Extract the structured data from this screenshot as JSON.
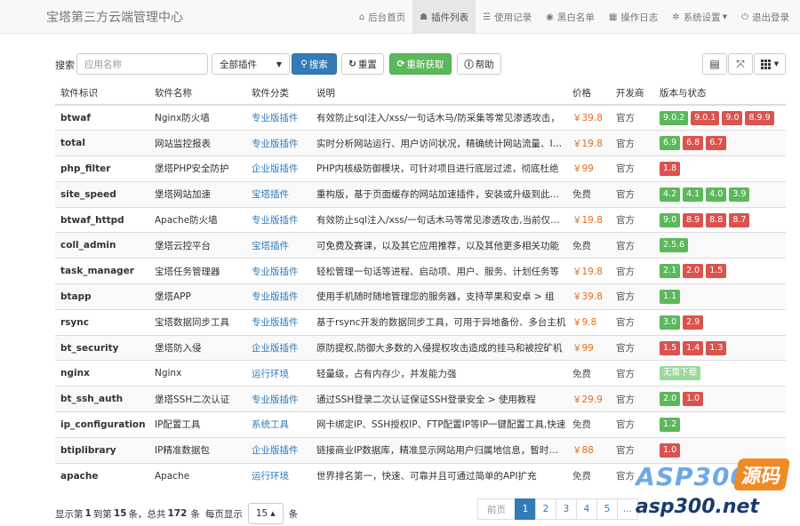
{
  "header": {
    "title": "宝塔第三方云端管理中心",
    "nav": [
      {
        "label": "后台首页",
        "icon": "home-icon",
        "glyph": "⌂"
      },
      {
        "label": "插件列表",
        "icon": "cubes-icon",
        "glyph": "☗"
      },
      {
        "label": "使用记录",
        "icon": "list-icon",
        "glyph": "☰"
      },
      {
        "label": "黑白名单",
        "icon": "globe-icon",
        "glyph": "◉"
      },
      {
        "label": "操作日志",
        "icon": "calendar-icon",
        "glyph": "▦"
      },
      {
        "label": "系统设置",
        "icon": "gear-icon",
        "glyph": "✲"
      },
      {
        "label": "退出登录",
        "icon": "power-icon",
        "glyph": "⏻"
      }
    ]
  },
  "toolbar": {
    "search_label": "搜索",
    "search_placeholder": "应用名称",
    "category_select": "全部插件",
    "search_button": "搜索",
    "reset_button": "重置",
    "refresh_button": "重新获取",
    "help_button": "帮助"
  },
  "table": {
    "columns": [
      "软件标识",
      "软件名称",
      "软件分类",
      "说明",
      "价格",
      "开发商",
      "版本与状态"
    ],
    "rows": [
      {
        "id": "btwaf",
        "name": "Nginx防火墙",
        "category": "专业版插件",
        "desc": "有效防止sql注入/xss/一句话木马/防采集等常见渗透攻击，",
        "price": "￥39.8",
        "vendor": "官方",
        "versions": [
          {
            "v": "9.0.2",
            "c": "green"
          },
          {
            "v": "9.0.1",
            "c": "red"
          },
          {
            "v": "9.0",
            "c": "red"
          },
          {
            "v": "8.9.9",
            "c": "red"
          }
        ]
      },
      {
        "id": "total",
        "name": "网站监控报表",
        "category": "专业版插件",
        "desc": "实时分析网站运行、用户访问状况，精确统计网站流量、IP、UV、PV",
        "price": "￥19.8",
        "vendor": "官方",
        "versions": [
          {
            "v": "6.9",
            "c": "green"
          },
          {
            "v": "6.8",
            "c": "red"
          },
          {
            "v": "6.7",
            "c": "red"
          }
        ]
      },
      {
        "id": "php_filter",
        "name": "堡塔PHP安全防护",
        "category": "企业版插件",
        "desc": "PHP内核级防御模块，可针对项目进行底层过滤，彻底杜绝",
        "price": "￥99",
        "vendor": "官方",
        "versions": [
          {
            "v": "1.8",
            "c": "red"
          }
        ]
      },
      {
        "id": "site_speed",
        "name": "堡塔网站加速",
        "category": "宝塔插件",
        "desc": "重构版，基于页面缓存的网站加速插件，安装或升级到此版本",
        "price": "免费",
        "vendor": "官方",
        "versions": [
          {
            "v": "4.2",
            "c": "green"
          },
          {
            "v": "4.1",
            "c": "green"
          },
          {
            "v": "4.0",
            "c": "green"
          },
          {
            "v": "3.9",
            "c": "green"
          }
        ]
      },
      {
        "id": "btwaf_httpd",
        "name": "Apache防火墙",
        "category": "专业版插件",
        "desc": "有效防止sql注入/xss/一句话木马等常见渗透攻击,当前仅支持",
        "price": "￥19.8",
        "vendor": "官方",
        "versions": [
          {
            "v": "9.0",
            "c": "green"
          },
          {
            "v": "8.9",
            "c": "red"
          },
          {
            "v": "8.8",
            "c": "red"
          },
          {
            "v": "8.7",
            "c": "red"
          }
        ]
      },
      {
        "id": "coll_admin",
        "name": "堡塔云控平台",
        "category": "宝塔插件",
        "desc": "可免费及赛课，以及其它应用推荐，以及其他更多相关功能",
        "price": "免费",
        "vendor": "官方",
        "versions": [
          {
            "v": "2.5.6",
            "c": "green"
          }
        ]
      },
      {
        "id": "task_manager",
        "name": "宝塔任务管理器",
        "category": "专业版插件",
        "desc": "轻松管理一句话等进程、启动项、用户、服务、计划任务等",
        "price": "￥19.8",
        "vendor": "官方",
        "versions": [
          {
            "v": "2.1",
            "c": "green"
          },
          {
            "v": "2.0",
            "c": "red"
          },
          {
            "v": "1.5",
            "c": "red"
          }
        ]
      },
      {
        "id": "btapp",
        "name": "堡塔APP",
        "category": "专业版插件",
        "desc": "使用手机随时随地管理您的服务器，支持苹果和安卓 > 组",
        "price": "￥39.8",
        "vendor": "官方",
        "versions": [
          {
            "v": "1.1",
            "c": "green"
          }
        ]
      },
      {
        "id": "rsync",
        "name": "宝塔数据同步工具",
        "category": "专业版插件",
        "desc": "基于rsync开发的数据同步工具，可用于异地备份、多台主机",
        "price": "￥9.8",
        "vendor": "官方",
        "versions": [
          {
            "v": "3.0",
            "c": "green"
          },
          {
            "v": "2.9",
            "c": "red"
          }
        ]
      },
      {
        "id": "bt_security",
        "name": "堡塔防入侵",
        "category": "企业版插件",
        "desc": "原防提权,防御大多数的入侵提权攻击造成的挂马和被控矿机",
        "price": "￥99",
        "vendor": "官方",
        "versions": [
          {
            "v": "1.5",
            "c": "red"
          },
          {
            "v": "1.4",
            "c": "red"
          },
          {
            "v": "1.3",
            "c": "red"
          }
        ]
      },
      {
        "id": "nginx",
        "name": "Nginx",
        "category": "运行环境",
        "desc": "轻量级，占有内存少，并发能力强",
        "price": "免费",
        "vendor": "官方",
        "versions": [
          {
            "v": "无需下载",
            "c": "light"
          }
        ]
      },
      {
        "id": "bt_ssh_auth",
        "name": "堡塔SSH二次认证",
        "category": "专业版插件",
        "desc": "通过SSH登录二次认证保证SSH登录安全 > 使用教程",
        "price": "￥29.9",
        "vendor": "官方",
        "versions": [
          {
            "v": "2.0",
            "c": "green"
          },
          {
            "v": "1.0",
            "c": "red"
          }
        ]
      },
      {
        "id": "ip_configuration",
        "name": "IP配置工具",
        "category": "系统工具",
        "desc": "网卡绑定IP、SSH授权IP、FTP配置IP等IP一键配置工具,快速",
        "price": "免费",
        "vendor": "官方",
        "versions": [
          {
            "v": "1.2",
            "c": "green"
          }
        ]
      },
      {
        "id": "btiplibrary",
        "name": "IP精准数据包",
        "category": "企业版插件",
        "desc": "链接商业IP数据库，精准显示网站用户归属地信息，暂时仅支持",
        "price": "￥88",
        "vendor": "官方",
        "versions": [
          {
            "v": "1.0",
            "c": "red"
          }
        ]
      },
      {
        "id": "apache",
        "name": "Apache",
        "category": "运行环境",
        "desc": "世界排名第一，快速、可靠并且可通过简单的API扩充",
        "price": "免费",
        "vendor": "官方",
        "versions": []
      }
    ]
  },
  "footer": {
    "prefix": "显示第",
    "start": "1",
    "to": "到第",
    "end": "15",
    "mid": "条，总共",
    "total": "172",
    "unit": "条",
    "per_page_label": "每页显示",
    "per_page": "15",
    "per_page_unit": "条"
  },
  "pagination": [
    "前页",
    "1",
    "2",
    "3",
    "4",
    "5",
    "..."
  ],
  "watermark": {
    "main": "ASP300",
    "badge": "源码",
    "url": "asp300.net"
  },
  "colors": {
    "primary": "#337ab7",
    "success": "#5cb85c",
    "danger": "#d9534f",
    "price": "#e66c1c"
  }
}
